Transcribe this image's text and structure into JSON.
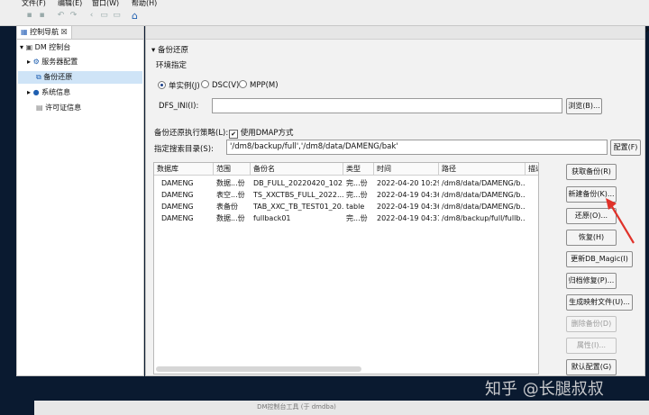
{
  "menubar": {
    "file": "文件(F)",
    "edit": "编辑(E)",
    "window": "窗口(W)",
    "help": "帮助(H)"
  },
  "toolbar": {
    "icons": [
      "save-icon",
      "save-all-icon",
      "undo-icon",
      "redo-icon",
      "back-icon",
      "forward-icon",
      "stop-icon",
      "home-icon"
    ]
  },
  "nav": {
    "tab_title": "控制导航",
    "tab_close": "☒",
    "tree": {
      "root": "DM 控制台",
      "items": [
        "服务器配置",
        "备份还原",
        "系统信息",
        "许可证信息"
      ]
    }
  },
  "main": {
    "section_title": "备份还原",
    "env_label": "环境指定",
    "radios": [
      {
        "label": "单实例(J)",
        "checked": true
      },
      {
        "label": "DSC(V)",
        "checked": false
      },
      {
        "label": "MPP(M)",
        "checked": false
      }
    ],
    "dfs_label": "DFS_INI(I):",
    "dfs_value": "",
    "browse_button": "浏览(B)...",
    "strategy_label": "备份还原执行策略(L):",
    "dmap_checkbox": "使用DMAP方式",
    "search_dir_label": "指定搜索目录(S):",
    "search_dir_value": "'/dm8/backup/full','/dm8/data/DAMENG/bak'",
    "config_button": "配置(F)"
  },
  "table": {
    "columns": [
      "数据库",
      "范围",
      "备份名",
      "类型",
      "时间",
      "路径",
      "描述"
    ],
    "rows": [
      [
        "DAMENG",
        "数据...份",
        "DB_FULL_20220420_102...",
        "完...份",
        "2022-04-20 10:29...",
        "/dm8/data/DAMENG/b...",
        ""
      ],
      [
        "DAMENG",
        "表空...份",
        "TS_XXCTBS_FULL_2022...",
        "完...份",
        "2022-04-19 04:36...",
        "/dm8/data/DAMENG/b...",
        ""
      ],
      [
        "DAMENG",
        "表备份",
        "TAB_XXC_TB_TEST01_20...",
        "table",
        "2022-04-19 04:36...",
        "/dm8/data/DAMENG/b...",
        ""
      ],
      [
        "DAMENG",
        "数据...份",
        "fullback01",
        "完...份",
        "2022-04-19 04:31...",
        "/dm8/backup/full/fullb...",
        ""
      ]
    ]
  },
  "side_buttons": [
    {
      "label": "获取备份(R)",
      "enabled": true
    },
    {
      "label": "新建备份(K)...",
      "enabled": true
    },
    {
      "label": "还原(O)...",
      "enabled": true
    },
    {
      "label": "恢复(H)",
      "enabled": true
    },
    {
      "label": "更新DB_Magic(I)",
      "enabled": true
    },
    {
      "label": "归档修复(P)...",
      "enabled": true
    },
    {
      "label": "生成映射文件(U)...",
      "enabled": true
    },
    {
      "label": "删除备份(D)",
      "enabled": false
    },
    {
      "label": "属性(I)...",
      "enabled": false
    },
    {
      "label": "默认配置(G)",
      "enabled": true
    }
  ],
  "watermark": "知乎 @长腿叔叔",
  "bottom_window_title": "DM控制台工具 (于 dmdba)",
  "colors": {
    "selection": "#cfe4f7",
    "annotation_arrow": "#e0322a",
    "desktop": "#0a1a30"
  }
}
